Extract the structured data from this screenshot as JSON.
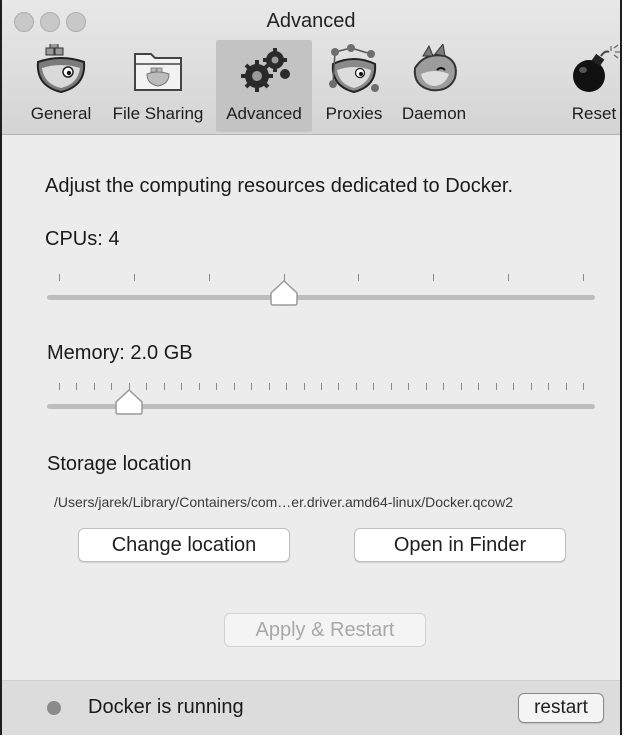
{
  "window": {
    "title": "Advanced"
  },
  "tabs": [
    {
      "label": "General",
      "icon": "whale-icon",
      "active": false
    },
    {
      "label": "File Sharing",
      "icon": "folder-icon",
      "active": false
    },
    {
      "label": "Advanced",
      "icon": "gears-icon",
      "active": true
    },
    {
      "label": "Proxies",
      "icon": "network-whale-icon",
      "active": false
    },
    {
      "label": "Daemon",
      "icon": "dragon-icon",
      "active": false
    },
    {
      "label": "Reset",
      "icon": "bomb-icon",
      "active": false
    }
  ],
  "main": {
    "description": "Adjust the computing resources dedicated to Docker.",
    "cpu": {
      "label": "CPUs: 4",
      "value": 4,
      "min": 1,
      "max": 8
    },
    "memory": {
      "label": "Memory: 2.0 GB",
      "value_gb": 2.0
    },
    "storage": {
      "heading": "Storage location",
      "path": "/Users/jarek/Library/Containers/com…er.driver.amd64-linux/Docker.qcow2",
      "change_label": "Change location",
      "open_label": "Open in Finder"
    },
    "apply_label": "Apply & Restart"
  },
  "status": {
    "text": "Docker is running",
    "restart_label": "restart"
  },
  "colors": {
    "track": "#bdbdbd",
    "active_tab": "#c3c3c3",
    "status_dot": "#8b8b8b"
  }
}
